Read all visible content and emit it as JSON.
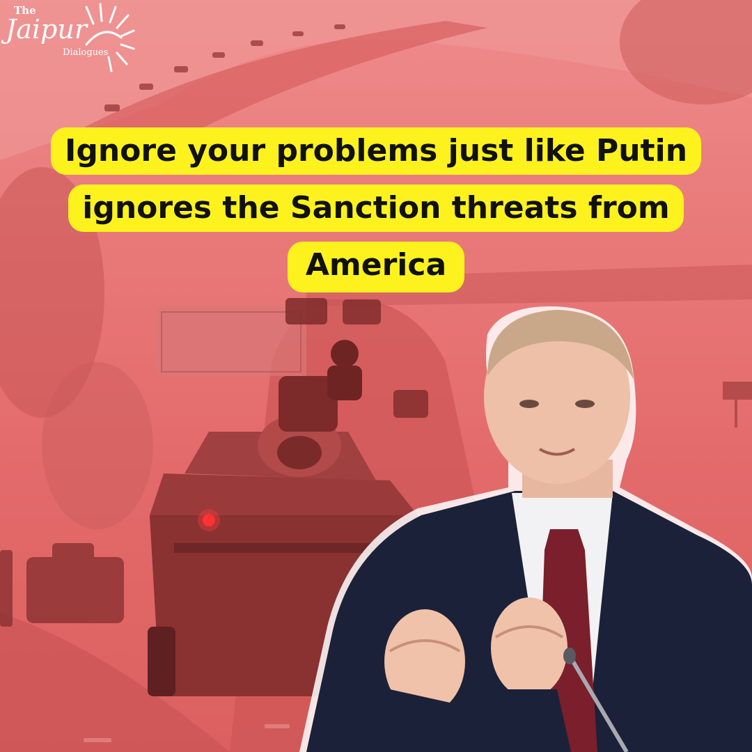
{
  "logo": {
    "the": "The",
    "name": "Jaipur",
    "tagline": "Dialogues",
    "icon": "sun-icon"
  },
  "headline": {
    "line1": "Ignore your problems just like Putin",
    "line2": "ignores the Sanction threats from",
    "line3": "America"
  },
  "colors": {
    "overlay": "#e86a6a",
    "headline_bg": "#fdf21e",
    "headline_text": "#111111",
    "suit": "#1b2138",
    "tie": "#7a1f2b"
  },
  "images": {
    "background": "armored-vehicle-convoy-photo",
    "foreground": "man-in-suit-photo"
  }
}
